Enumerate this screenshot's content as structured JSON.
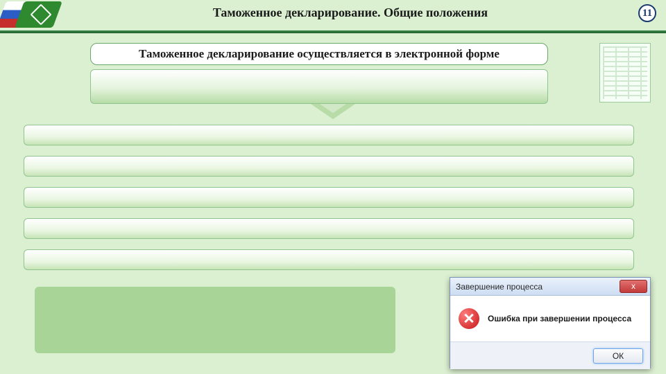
{
  "header": {
    "title": "Таможенное декларирование. Общие положения",
    "page_number": "11"
  },
  "subtitle": "Таможенное декларирование осуществляется в электронной форме",
  "rows": [
    "",
    "",
    "",
    "",
    ""
  ],
  "dialog": {
    "title": "Завершение процесса",
    "message": "Ошибка при завершении процесса",
    "close_label": "x",
    "ok_label": "ОК"
  }
}
